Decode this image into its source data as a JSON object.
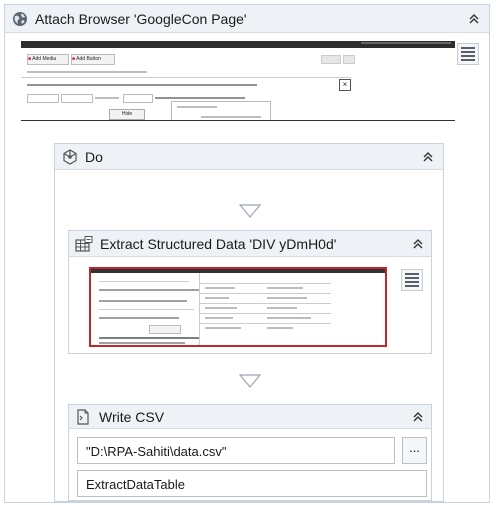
{
  "attach_browser": {
    "title": "Attach Browser 'GoogleCon Page'",
    "icon": "globe-icon",
    "preview": {
      "toolbar_buttons": [
        "Add Media",
        "Add Button"
      ],
      "button_label": "Hide"
    }
  },
  "do_sequence": {
    "title": "Do",
    "icon": "sequence-icon"
  },
  "extract_structured_data": {
    "title": "Extract Structured Data 'DIV  yDmH0d'",
    "icon": "table-grid-icon"
  },
  "write_csv": {
    "title": "Write CSV",
    "icon": "document-icon",
    "file_path": "\"D:\\RPA-Sahiti\\data.csv\"",
    "browse_label": "...",
    "data_table": "ExtractDataTable"
  },
  "colors": {
    "header_bg": "#eef2f6",
    "border": "#c9d3dd",
    "preview_red": "#c0262d",
    "preview_dark": "#333333"
  }
}
